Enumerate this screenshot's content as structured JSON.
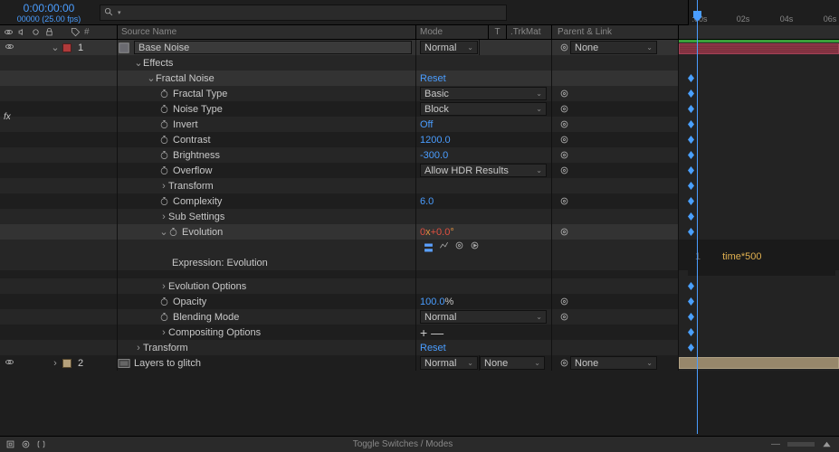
{
  "header": {
    "timecode": "0:00:00:00",
    "frame_fps": "00000 (25.00 fps)",
    "search_placeholder": "",
    "ruler_ticks": [
      ":00s",
      "02s",
      "04s",
      "06s"
    ]
  },
  "columns": {
    "hash": "#",
    "source": "Source Name",
    "mode": "Mode",
    "t": "T",
    "trkmat": ".TrkMat",
    "parent": "Parent & Link"
  },
  "layers": [
    {
      "n": "1",
      "color": "red",
      "name": "Base Noise",
      "mode": "Normal",
      "trk": "",
      "parent": "None"
    },
    {
      "n": "2",
      "color": "tan",
      "name": "Layers to glitch",
      "mode": "Normal",
      "trk": "None",
      "parent": "None"
    }
  ],
  "groups": {
    "effects": "Effects",
    "fractal": "Fractal Noise",
    "transform": "Transform",
    "subsettings": "Sub Settings",
    "evolution_options": "Evolution Options",
    "compositing": "Compositing Options",
    "transform2": "Transform"
  },
  "props": {
    "fractal_type": {
      "label": "Fractal Type",
      "value": "Basic"
    },
    "noise_type": {
      "label": "Noise Type",
      "value": "Block"
    },
    "invert": {
      "label": "Invert",
      "value": "Off"
    },
    "contrast": {
      "label": "Contrast",
      "value": "1200.0"
    },
    "brightness": {
      "label": "Brightness",
      "value": "-300.0"
    },
    "overflow": {
      "label": "Overflow",
      "value": "Allow HDR Results"
    },
    "complexity": {
      "label": "Complexity",
      "value": "6.0"
    },
    "evolution": {
      "label": "Evolution",
      "value_turns": "0",
      "value_x": "x",
      "value_deg": "+0.0",
      "value_suffix": "°"
    },
    "expression_label": "Expression: Evolution",
    "opacity": {
      "label": "Opacity",
      "value": "100.0",
      "suffix": " %"
    },
    "blending": {
      "label": "Blending Mode",
      "value": "Normal"
    }
  },
  "actions": {
    "reset": "Reset",
    "reset2": "Reset"
  },
  "expression": {
    "line": "1",
    "code": "time*500"
  },
  "footer": {
    "toggle": "Toggle Switches / Modes"
  }
}
